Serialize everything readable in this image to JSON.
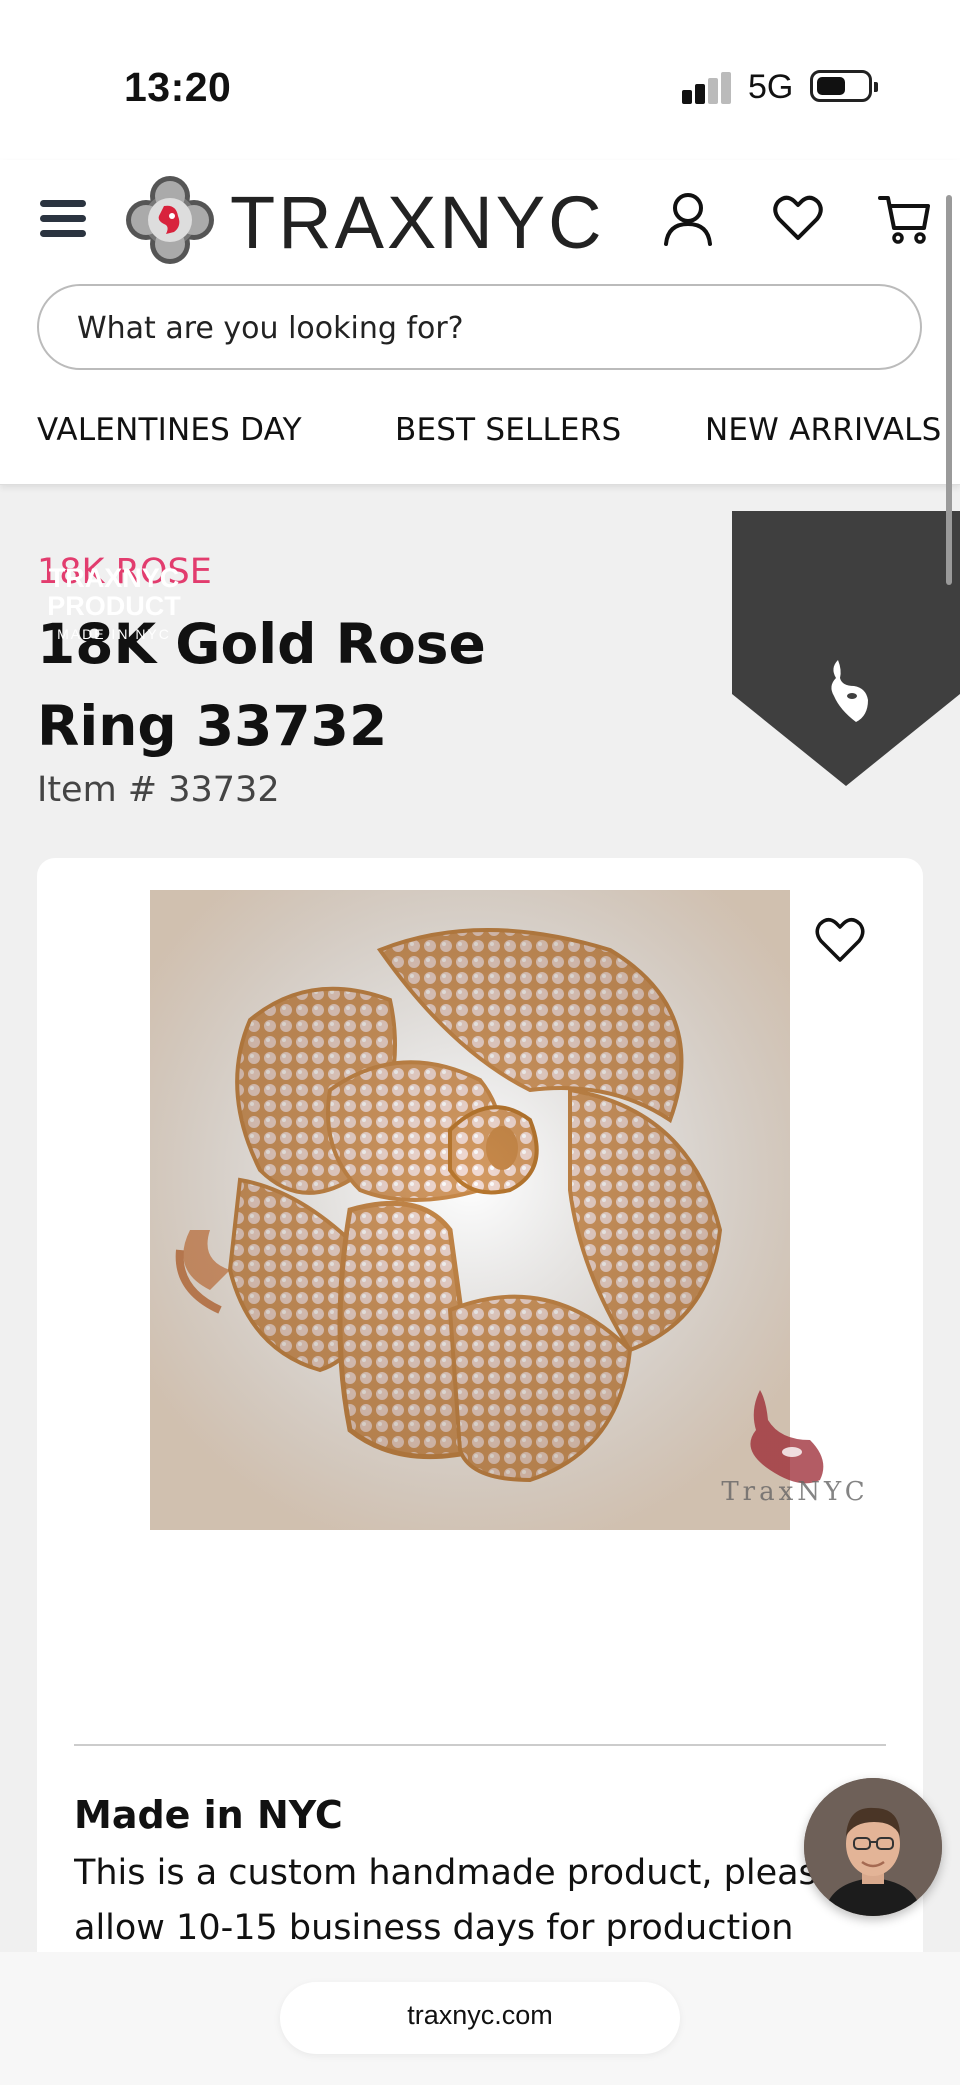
{
  "status_bar": {
    "time": "13:20",
    "network": "5G",
    "icons": [
      "signal-icon",
      "battery-icon"
    ]
  },
  "header": {
    "logo_text": "TRAXNYC",
    "icons": [
      "menu-icon",
      "account-icon",
      "wishlist-heart-icon",
      "cart-icon"
    ],
    "search": {
      "placeholder": "What are you looking for?"
    },
    "nav_tabs": [
      {
        "label": "VALENTINES DAY"
      },
      {
        "label": "BEST SELLERS"
      },
      {
        "label": "NEW ARRIVALS"
      }
    ]
  },
  "product": {
    "category": "18K ROSE",
    "title": "18K Gold Rose Ring 33732",
    "item_number": "Item # 33732",
    "badge": {
      "line1": "TRAXNYC",
      "line2": "PRODUCT",
      "line3": "MADE IN NYC"
    },
    "watermark_text": "TraxNYC",
    "made_in": {
      "title": "Made in NYC",
      "line1": "This is a custom handmade product, please",
      "line2": "allow 10-15 business days for production"
    }
  },
  "browser": {
    "url": "traxnyc.com"
  },
  "colors": {
    "accent_pink": "#e23c6e",
    "badge_dark": "#3f3f3f",
    "page_bg": "#f0f0f0"
  }
}
